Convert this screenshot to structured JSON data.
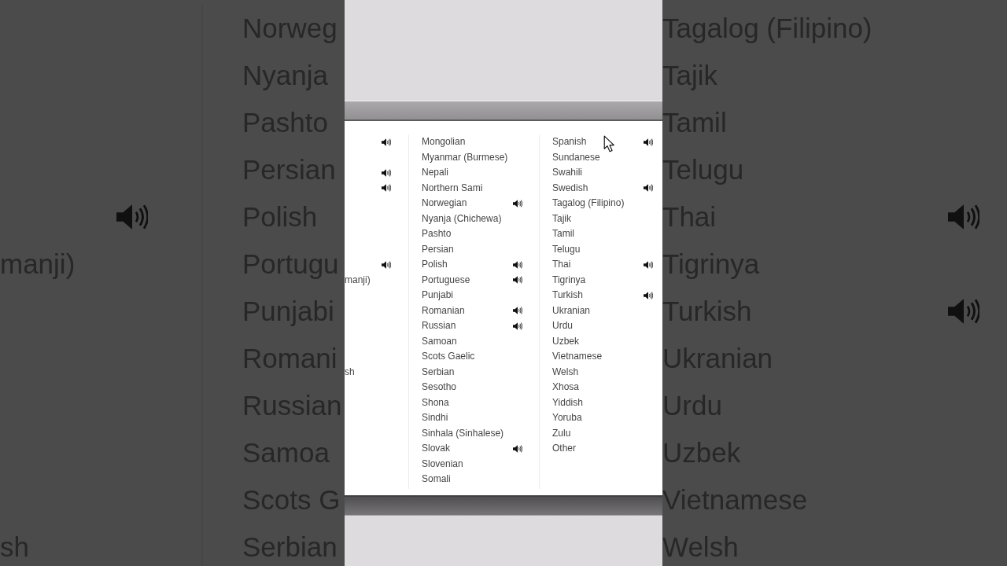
{
  "left_backdrop": {
    "column_1": [
      {
        "audio": false
      },
      {
        "audio": false
      },
      {
        "audio": false
      },
      {
        "audio": false
      },
      {
        "audio": true
      },
      {
        "label": "manji)",
        "audio": false
      },
      {
        "audio": false
      },
      {
        "audio": false
      },
      {
        "audio": false
      },
      {
        "audio": false
      },
      {
        "audio": false
      },
      {
        "label": "sh",
        "audio": false
      }
    ],
    "column_2": [
      {
        "label": "Norweg"
      },
      {
        "label": "Nyanja"
      },
      {
        "label": "Pashto"
      },
      {
        "label": "Persian"
      },
      {
        "label": "Polish"
      },
      {
        "label": "Portugu"
      },
      {
        "label": "Punjabi"
      },
      {
        "label": "Romani"
      },
      {
        "label": "Russian"
      },
      {
        "label": "Samoa"
      },
      {
        "label": "Scots G"
      },
      {
        "label": "Serbian"
      }
    ]
  },
  "panel": {
    "column_1": [
      {
        "audio": true
      },
      {
        "audio": false
      },
      {
        "audio": true
      },
      {
        "audio": true
      },
      {
        "audio": false
      },
      {
        "audio": false
      },
      {
        "audio": false
      },
      {
        "audio": false
      },
      {
        "audio": true
      },
      {
        "label": "manji)",
        "audio": false
      },
      {
        "audio": false
      },
      {
        "audio": false
      },
      {
        "audio": false
      },
      {
        "audio": false
      },
      {
        "audio": false
      },
      {
        "label": "sh",
        "audio": false
      }
    ],
    "column_2": [
      {
        "label": "Mongolian",
        "audio": false
      },
      {
        "label": "Myanmar (Burmese)",
        "audio": false
      },
      {
        "label": "Nepali",
        "audio": false
      },
      {
        "label": "Northern Sami",
        "audio": false
      },
      {
        "label": "Norwegian",
        "audio": true
      },
      {
        "label": "Nyanja (Chichewa)",
        "audio": false
      },
      {
        "label": "Pashto",
        "audio": false
      },
      {
        "label": "Persian",
        "audio": false
      },
      {
        "label": "Polish",
        "audio": true
      },
      {
        "label": "Portuguese",
        "audio": true
      },
      {
        "label": "Punjabi",
        "audio": false
      },
      {
        "label": "Romanian",
        "audio": true
      },
      {
        "label": "Russian",
        "audio": true
      },
      {
        "label": "Samoan",
        "audio": false
      },
      {
        "label": "Scots Gaelic",
        "audio": false
      },
      {
        "label": "Serbian",
        "audio": false
      },
      {
        "label": "Sesotho",
        "audio": false
      },
      {
        "label": "Shona",
        "audio": false
      },
      {
        "label": "Sindhi",
        "audio": false
      },
      {
        "label": "Sinhala (Sinhalese)",
        "audio": false
      },
      {
        "label": "Slovak",
        "audio": true
      },
      {
        "label": "Slovenian",
        "audio": false
      },
      {
        "label": "Somali",
        "audio": false
      }
    ],
    "column_3": [
      {
        "label": "Spanish",
        "audio": true
      },
      {
        "label": "Sundanese",
        "audio": false
      },
      {
        "label": "Swahili",
        "audio": false
      },
      {
        "label": "Swedish",
        "audio": true
      },
      {
        "label": "Tagalog (Filipino)",
        "audio": false
      },
      {
        "label": "Tajik",
        "audio": false
      },
      {
        "label": "Tamil",
        "audio": false
      },
      {
        "label": "Telugu",
        "audio": false
      },
      {
        "label": "Thai",
        "audio": true
      },
      {
        "label": "Tigrinya",
        "audio": false
      },
      {
        "label": "Turkish",
        "audio": true
      },
      {
        "label": "Ukranian",
        "audio": false
      },
      {
        "label": "Urdu",
        "audio": false
      },
      {
        "label": "Uzbek",
        "audio": false
      },
      {
        "label": "Vietnamese",
        "audio": false
      },
      {
        "label": "Welsh",
        "audio": false
      },
      {
        "label": "Xhosa",
        "audio": false
      },
      {
        "label": "Yiddish",
        "audio": false
      },
      {
        "label": "Yoruba",
        "audio": false
      },
      {
        "label": "Zulu",
        "audio": false
      },
      {
        "label": "Other",
        "audio": false
      }
    ]
  },
  "right_backdrop": {
    "column_3": [
      {
        "label": "Tagalog (Filipino)",
        "audio": false
      },
      {
        "label": "Tajik",
        "audio": false
      },
      {
        "label": "Tamil",
        "audio": false
      },
      {
        "label": "Telugu",
        "audio": false
      },
      {
        "label": "Thai",
        "audio": true
      },
      {
        "label": "Tigrinya",
        "audio": false
      },
      {
        "label": "Turkish",
        "audio": true
      },
      {
        "label": "Ukranian",
        "audio": false
      },
      {
        "label": "Urdu",
        "audio": false
      },
      {
        "label": "Uzbek",
        "audio": false
      },
      {
        "label": "Vietnamese",
        "audio": false
      },
      {
        "label": "Welsh",
        "audio": false
      }
    ]
  }
}
